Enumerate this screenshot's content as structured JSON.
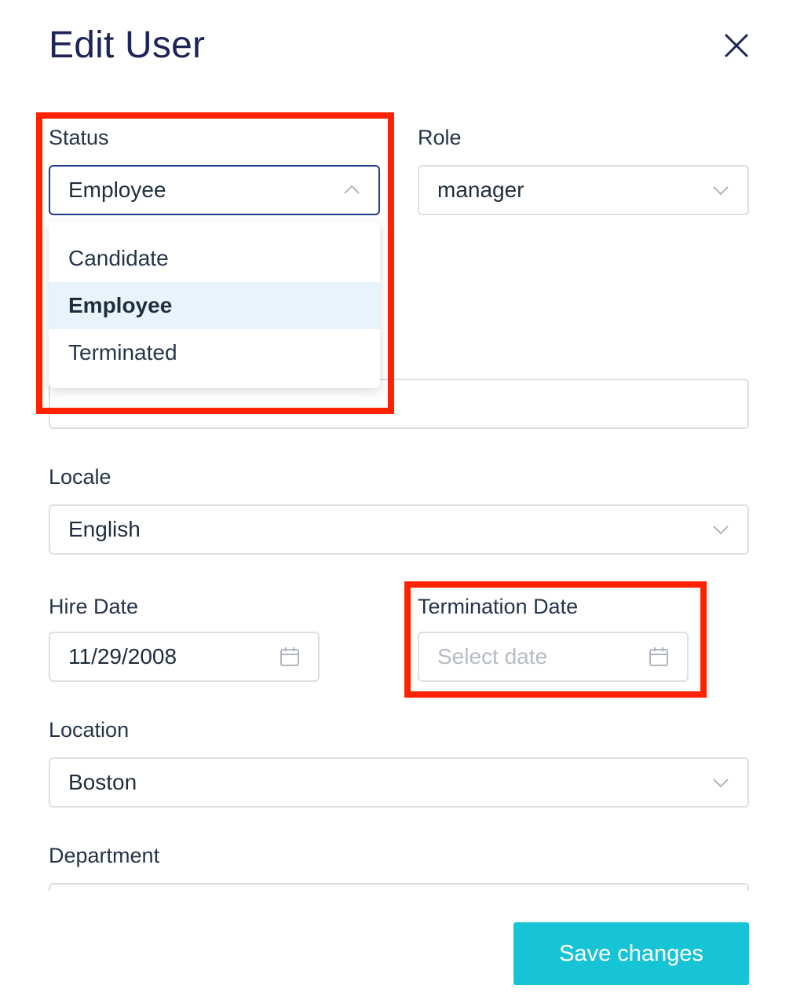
{
  "modal": {
    "title": "Edit User",
    "close_icon": "close-icon"
  },
  "status": {
    "label": "Status",
    "value": "Employee",
    "options": [
      "Candidate",
      "Employee",
      "Terminated"
    ],
    "selected": "Employee"
  },
  "role": {
    "label": "Role",
    "value": "manager"
  },
  "locale": {
    "label": "Locale",
    "value": "English"
  },
  "hire_date": {
    "label": "Hire Date",
    "value": "11/29/2008"
  },
  "termination_date": {
    "label": "Termination Date",
    "placeholder": "Select date"
  },
  "location": {
    "label": "Location",
    "value": "Boston"
  },
  "department": {
    "label": "Department"
  },
  "footer": {
    "save_label": "Save changes"
  },
  "colors": {
    "highlight": "#fe2200",
    "primary_button": "#17c4d6",
    "title": "#1d2457",
    "selected_option_bg": "#e8f4fc",
    "focus_border": "#1d3b8f"
  }
}
